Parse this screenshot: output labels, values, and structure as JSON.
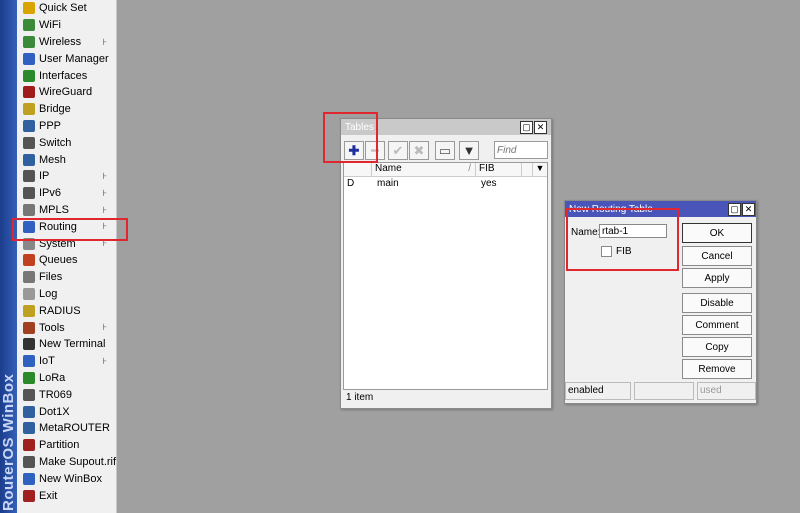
{
  "sidebar": {
    "brand": "RouterOS WinBox",
    "items": [
      {
        "label": "Quick Set",
        "icon": "quick-set-icon",
        "submenu": false
      },
      {
        "label": "WiFi",
        "icon": "wifi-icon",
        "submenu": false
      },
      {
        "label": "Wireless",
        "icon": "wireless-icon",
        "submenu": true
      },
      {
        "label": "User Manager",
        "icon": "user-manager-icon",
        "submenu": false
      },
      {
        "label": "Interfaces",
        "icon": "interfaces-icon",
        "submenu": false
      },
      {
        "label": "WireGuard",
        "icon": "wireguard-icon",
        "submenu": false
      },
      {
        "label": "Bridge",
        "icon": "bridge-icon",
        "submenu": false
      },
      {
        "label": "PPP",
        "icon": "ppp-icon",
        "submenu": false
      },
      {
        "label": "Switch",
        "icon": "switch-icon",
        "submenu": false
      },
      {
        "label": "Mesh",
        "icon": "mesh-icon",
        "submenu": false
      },
      {
        "label": "IP",
        "icon": "ip-icon",
        "submenu": true
      },
      {
        "label": "IPv6",
        "icon": "ipv6-icon",
        "submenu": true
      },
      {
        "label": "MPLS",
        "icon": "mpls-icon",
        "submenu": true
      },
      {
        "label": "Routing",
        "icon": "routing-icon",
        "submenu": true
      },
      {
        "label": "System",
        "icon": "system-icon",
        "submenu": true
      },
      {
        "label": "Queues",
        "icon": "queues-icon",
        "submenu": false
      },
      {
        "label": "Files",
        "icon": "files-icon",
        "submenu": false
      },
      {
        "label": "Log",
        "icon": "log-icon",
        "submenu": false
      },
      {
        "label": "RADIUS",
        "icon": "radius-icon",
        "submenu": false
      },
      {
        "label": "Tools",
        "icon": "tools-icon",
        "submenu": true
      },
      {
        "label": "New Terminal",
        "icon": "terminal-icon",
        "submenu": false
      },
      {
        "label": "IoT",
        "icon": "iot-icon",
        "submenu": true
      },
      {
        "label": "LoRa",
        "icon": "lora-icon",
        "submenu": false
      },
      {
        "label": "TR069",
        "icon": "tr069-icon",
        "submenu": false
      },
      {
        "label": "Dot1X",
        "icon": "dot1x-icon",
        "submenu": false
      },
      {
        "label": "MetaROUTER",
        "icon": "metarouter-icon",
        "submenu": false
      },
      {
        "label": "Partition",
        "icon": "partition-icon",
        "submenu": false
      },
      {
        "label": "Make Supout.rif",
        "icon": "supout-icon",
        "submenu": false
      },
      {
        "label": "New WinBox",
        "icon": "winbox-icon",
        "submenu": false
      },
      {
        "label": "Exit",
        "icon": "exit-icon",
        "submenu": false
      }
    ]
  },
  "tables_window": {
    "title": "Tables",
    "find_placeholder": "Find",
    "columns": [
      "Name",
      "FIB"
    ],
    "rows": [
      {
        "flag": "D",
        "name": "main",
        "fib": "yes"
      }
    ],
    "status": "1 item"
  },
  "new_routing_table": {
    "title": "New Routing Table",
    "name_label": "Name:",
    "name_value": "rtab-1",
    "fib_label": "FIB",
    "fib_checked": false,
    "buttons": [
      "OK",
      "Cancel",
      "Apply",
      "Disable",
      "Comment",
      "Copy",
      "Remove"
    ],
    "status": [
      "enabled",
      "",
      "used"
    ]
  },
  "colors": {
    "highlight_box": "#e0262e",
    "active_titlebar": "#4a55b9",
    "add_icon": "#1c2fa0"
  }
}
